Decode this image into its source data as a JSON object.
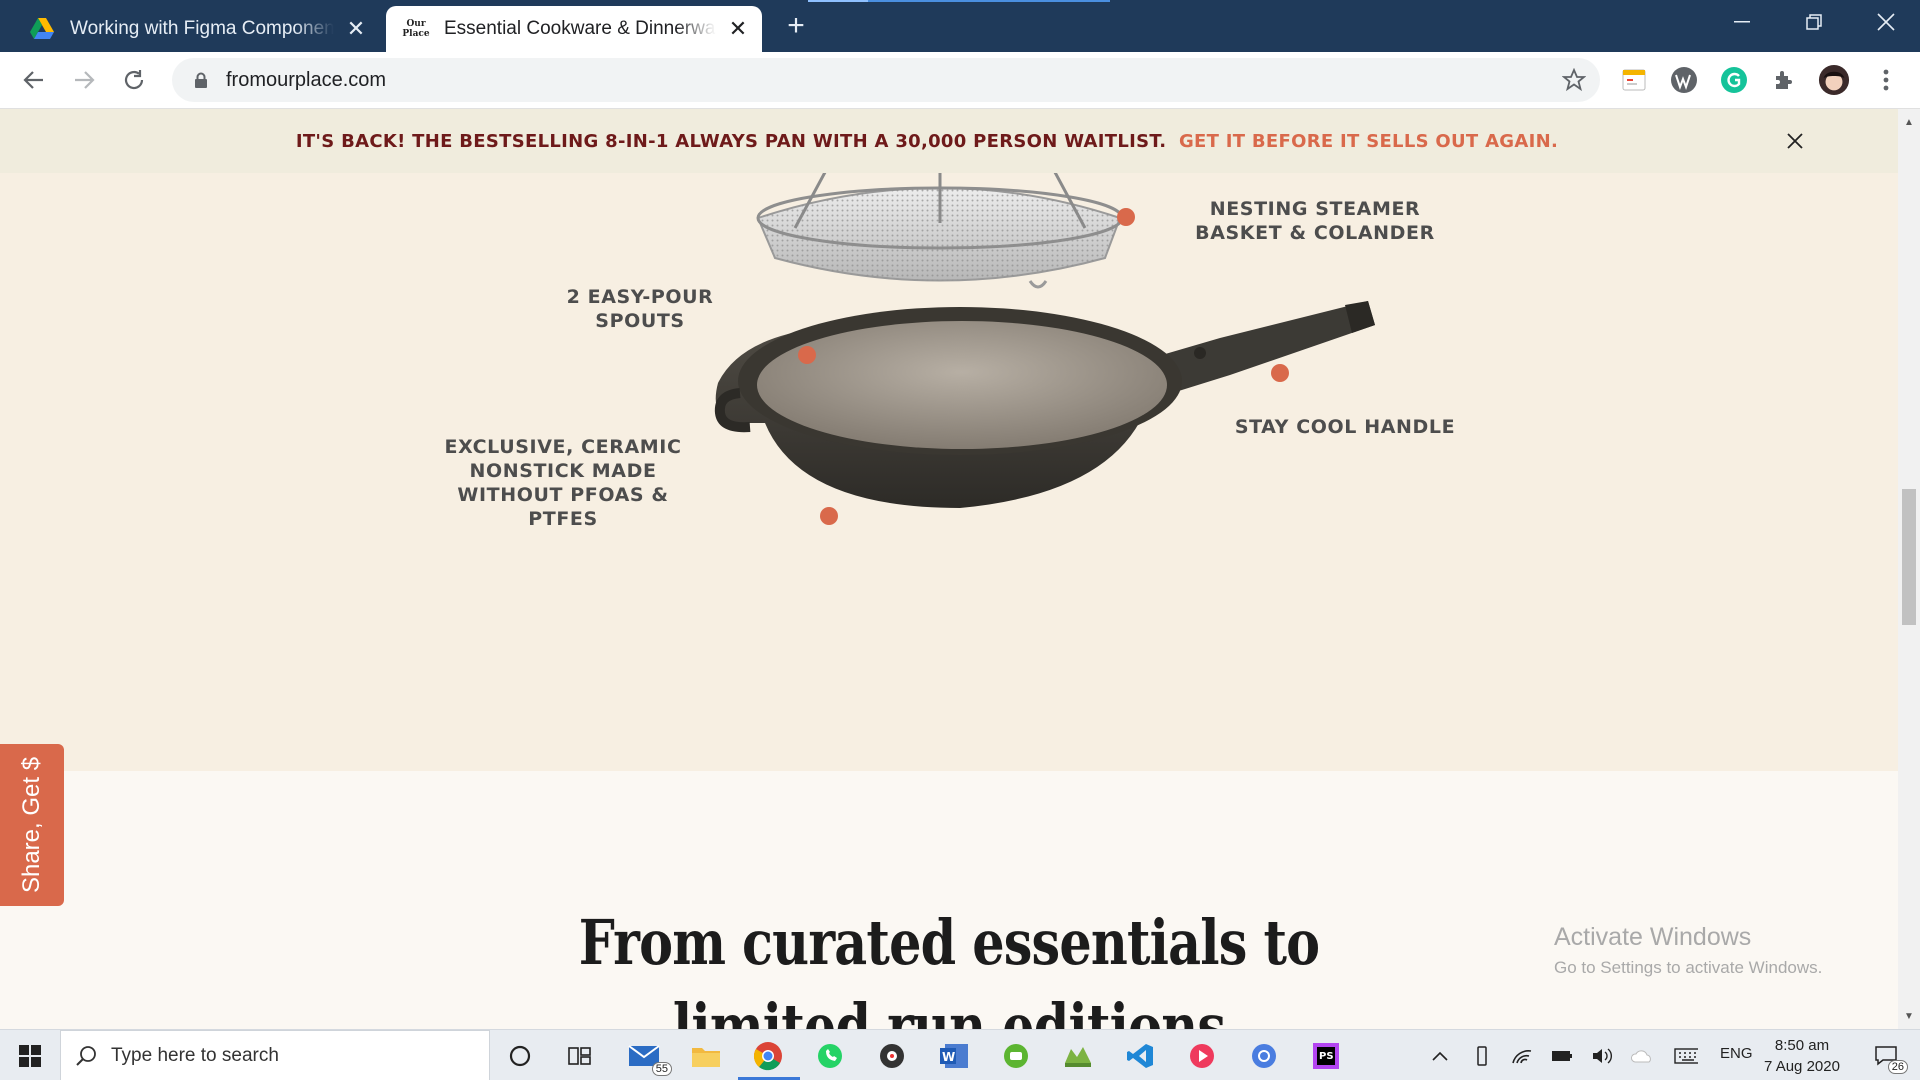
{
  "browser": {
    "tabs": [
      {
        "title": "Working with Figma Components",
        "favicon": "google-drive-icon"
      },
      {
        "title": "Essential Cookware & Dinnerware",
        "favicon": "our-place-icon",
        "favicon_text_1": "Our",
        "favicon_text_2": "Place"
      }
    ],
    "url": "fromourplace.com",
    "extensions": [
      "tab-manager-icon",
      "wordpress-icon",
      "grammarly-icon",
      "puzzle-icon",
      "profile-avatar"
    ]
  },
  "announcement": {
    "text": "IT'S BACK! THE BESTSELLING 8-IN-1 ALWAYS PAN WITH A 30,000 PERSON WAITLIST.",
    "link": "GET IT BEFORE IT SELLS OUT AGAIN."
  },
  "features": {
    "steamer": {
      "line1": "NESTING STEAMER",
      "line2": "BASKET & COLANDER"
    },
    "spouts": {
      "line1": "2 EASY-POUR",
      "line2": "SPOUTS"
    },
    "handle": {
      "line1": "STAY COOL HANDLE"
    },
    "nonstick": {
      "line1": "EXCLUSIVE, CERAMIC",
      "line2": "NONSTICK MADE",
      "line3": "WITHOUT PFOAS &",
      "line4": "PTFES"
    }
  },
  "headline": {
    "line1": "From curated essentials to",
    "line2": "limited run editions"
  },
  "share_tab": "Share, Get $",
  "watermark": {
    "title": "Activate Windows",
    "subtitle": "Go to Settings to activate Windows."
  },
  "taskbar": {
    "search_placeholder": "Type here to search",
    "mail_badge": "55",
    "language": "ENG",
    "time": "8:50 am",
    "date": "7 Aug 2020",
    "notifications": "26"
  },
  "colors": {
    "accent": "#d9694b",
    "announcement_text": "#6e1a1a",
    "hero_bg": "#f7efe2",
    "tabbar_bg": "#1f3a5a"
  }
}
